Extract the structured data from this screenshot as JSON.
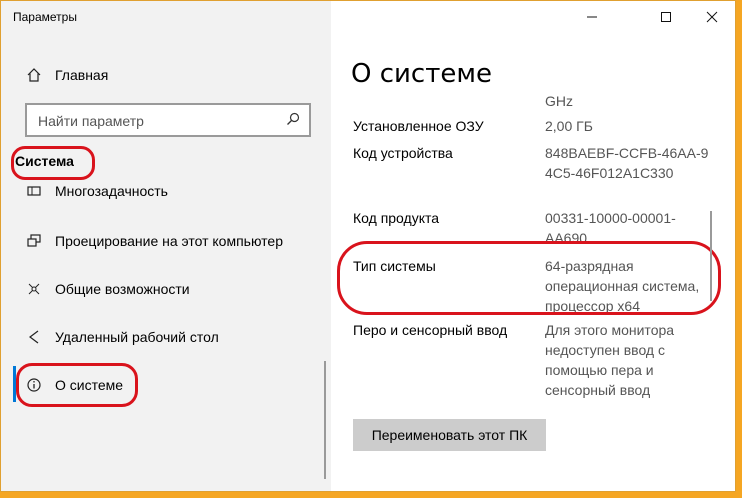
{
  "window": {
    "title": "Параметры"
  },
  "sidebar": {
    "home_label": "Главная",
    "search_placeholder": "Найти параметр",
    "section_title": "Система",
    "items": [
      {
        "label": "Многозадачность",
        "icon": "multitasking-icon"
      },
      {
        "label": "Проецирование на этот компьютер",
        "icon": "projecting-icon"
      },
      {
        "label": "Общие возможности",
        "icon": "shared-experiences-icon"
      },
      {
        "label": "Удаленный рабочий стол",
        "icon": "remote-desktop-icon"
      },
      {
        "label": "О системе",
        "icon": "info-icon"
      }
    ]
  },
  "main": {
    "title": "О системе",
    "partial_value": "GHz",
    "properties": [
      {
        "label": "Установленное ОЗУ",
        "value": "2,00 ГБ"
      },
      {
        "label": "Код устройства",
        "value": "848BAEBF-CCFB-46AA-94C5-46F012A1C330"
      },
      {
        "label": "Код продукта",
        "value": "00331-10000-00001-AA690"
      },
      {
        "label": "Тип системы",
        "value": "64-разрядная операционная система, процессор x64"
      },
      {
        "label": "Перо и сенсорный ввод",
        "value": "Для этого монитора недоступен ввод с помощью пера и сенсорный ввод"
      }
    ],
    "rename_button": "Переименовать этот ПК"
  },
  "colors": {
    "annotation": "#d9131c",
    "frame": "#f5a623"
  }
}
